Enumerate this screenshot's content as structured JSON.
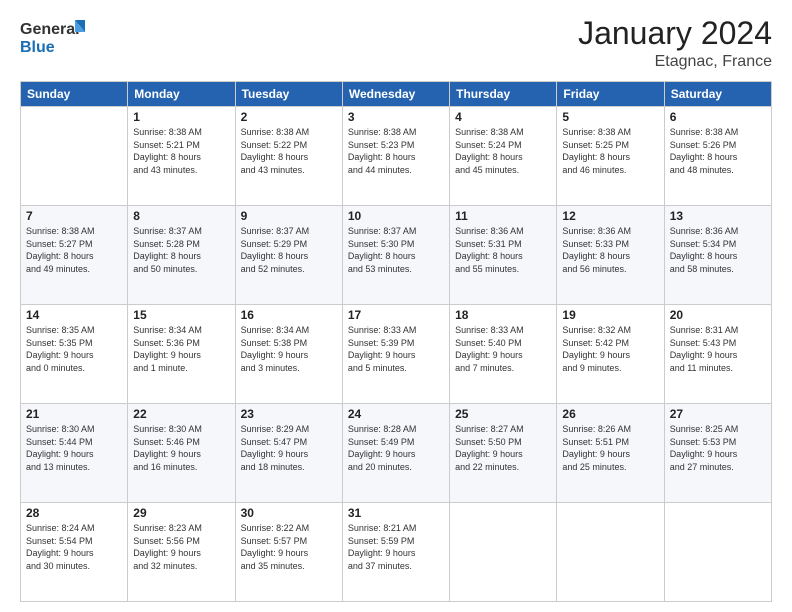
{
  "header": {
    "logo_line1": "General",
    "logo_line2": "Blue",
    "month": "January 2024",
    "location": "Etagnac, France"
  },
  "weekdays": [
    "Sunday",
    "Monday",
    "Tuesday",
    "Wednesday",
    "Thursday",
    "Friday",
    "Saturday"
  ],
  "weeks": [
    [
      {
        "day": "",
        "info": ""
      },
      {
        "day": "1",
        "info": "Sunrise: 8:38 AM\nSunset: 5:21 PM\nDaylight: 8 hours\nand 43 minutes."
      },
      {
        "day": "2",
        "info": "Sunrise: 8:38 AM\nSunset: 5:22 PM\nDaylight: 8 hours\nand 43 minutes."
      },
      {
        "day": "3",
        "info": "Sunrise: 8:38 AM\nSunset: 5:23 PM\nDaylight: 8 hours\nand 44 minutes."
      },
      {
        "day": "4",
        "info": "Sunrise: 8:38 AM\nSunset: 5:24 PM\nDaylight: 8 hours\nand 45 minutes."
      },
      {
        "day": "5",
        "info": "Sunrise: 8:38 AM\nSunset: 5:25 PM\nDaylight: 8 hours\nand 46 minutes."
      },
      {
        "day": "6",
        "info": "Sunrise: 8:38 AM\nSunset: 5:26 PM\nDaylight: 8 hours\nand 48 minutes."
      }
    ],
    [
      {
        "day": "7",
        "info": ""
      },
      {
        "day": "8",
        "info": "Sunrise: 8:37 AM\nSunset: 5:28 PM\nDaylight: 8 hours\nand 50 minutes."
      },
      {
        "day": "9",
        "info": "Sunrise: 8:37 AM\nSunset: 5:29 PM\nDaylight: 8 hours\nand 52 minutes."
      },
      {
        "day": "10",
        "info": "Sunrise: 8:37 AM\nSunset: 5:30 PM\nDaylight: 8 hours\nand 53 minutes."
      },
      {
        "day": "11",
        "info": "Sunrise: 8:36 AM\nSunset: 5:31 PM\nDaylight: 8 hours\nand 55 minutes."
      },
      {
        "day": "12",
        "info": "Sunrise: 8:36 AM\nSunset: 5:33 PM\nDaylight: 8 hours\nand 56 minutes."
      },
      {
        "day": "13",
        "info": "Sunrise: 8:36 AM\nSunset: 5:34 PM\nDaylight: 8 hours\nand 58 minutes."
      }
    ],
    [
      {
        "day": "14",
        "info": "Sunrise: 8:35 AM\nSunset: 5:35 PM\nDaylight: 9 hours\nand 0 minutes."
      },
      {
        "day": "15",
        "info": "Sunrise: 8:34 AM\nSunset: 5:36 PM\nDaylight: 9 hours\nand 1 minute."
      },
      {
        "day": "16",
        "info": "Sunrise: 8:34 AM\nSunset: 5:38 PM\nDaylight: 9 hours\nand 3 minutes."
      },
      {
        "day": "17",
        "info": "Sunrise: 8:33 AM\nSunset: 5:39 PM\nDaylight: 9 hours\nand 5 minutes."
      },
      {
        "day": "18",
        "info": "Sunrise: 8:33 AM\nSunset: 5:40 PM\nDaylight: 9 hours\nand 7 minutes."
      },
      {
        "day": "19",
        "info": "Sunrise: 8:32 AM\nSunset: 5:42 PM\nDaylight: 9 hours\nand 9 minutes."
      },
      {
        "day": "20",
        "info": "Sunrise: 8:31 AM\nSunset: 5:43 PM\nDaylight: 9 hours\nand 11 minutes."
      }
    ],
    [
      {
        "day": "21",
        "info": "Sunrise: 8:30 AM\nSunset: 5:44 PM\nDaylight: 9 hours\nand 13 minutes."
      },
      {
        "day": "22",
        "info": "Sunrise: 8:30 AM\nSunset: 5:46 PM\nDaylight: 9 hours\nand 16 minutes."
      },
      {
        "day": "23",
        "info": "Sunrise: 8:29 AM\nSunset: 5:47 PM\nDaylight: 9 hours\nand 18 minutes."
      },
      {
        "day": "24",
        "info": "Sunrise: 8:28 AM\nSunset: 5:49 PM\nDaylight: 9 hours\nand 20 minutes."
      },
      {
        "day": "25",
        "info": "Sunrise: 8:27 AM\nSunset: 5:50 PM\nDaylight: 9 hours\nand 22 minutes."
      },
      {
        "day": "26",
        "info": "Sunrise: 8:26 AM\nSunset: 5:51 PM\nDaylight: 9 hours\nand 25 minutes."
      },
      {
        "day": "27",
        "info": "Sunrise: 8:25 AM\nSunset: 5:53 PM\nDaylight: 9 hours\nand 27 minutes."
      }
    ],
    [
      {
        "day": "28",
        "info": "Sunrise: 8:24 AM\nSunset: 5:54 PM\nDaylight: 9 hours\nand 30 minutes."
      },
      {
        "day": "29",
        "info": "Sunrise: 8:23 AM\nSunset: 5:56 PM\nDaylight: 9 hours\nand 32 minutes."
      },
      {
        "day": "30",
        "info": "Sunrise: 8:22 AM\nSunset: 5:57 PM\nDaylight: 9 hours\nand 35 minutes."
      },
      {
        "day": "31",
        "info": "Sunrise: 8:21 AM\nSunset: 5:59 PM\nDaylight: 9 hours\nand 37 minutes."
      },
      {
        "day": "",
        "info": ""
      },
      {
        "day": "",
        "info": ""
      },
      {
        "day": "",
        "info": ""
      }
    ]
  ],
  "week1_sunday_info": "Sunrise: 8:38 AM\nSunset: 5:27 PM\nDaylight: 8 hours\nand 49 minutes."
}
